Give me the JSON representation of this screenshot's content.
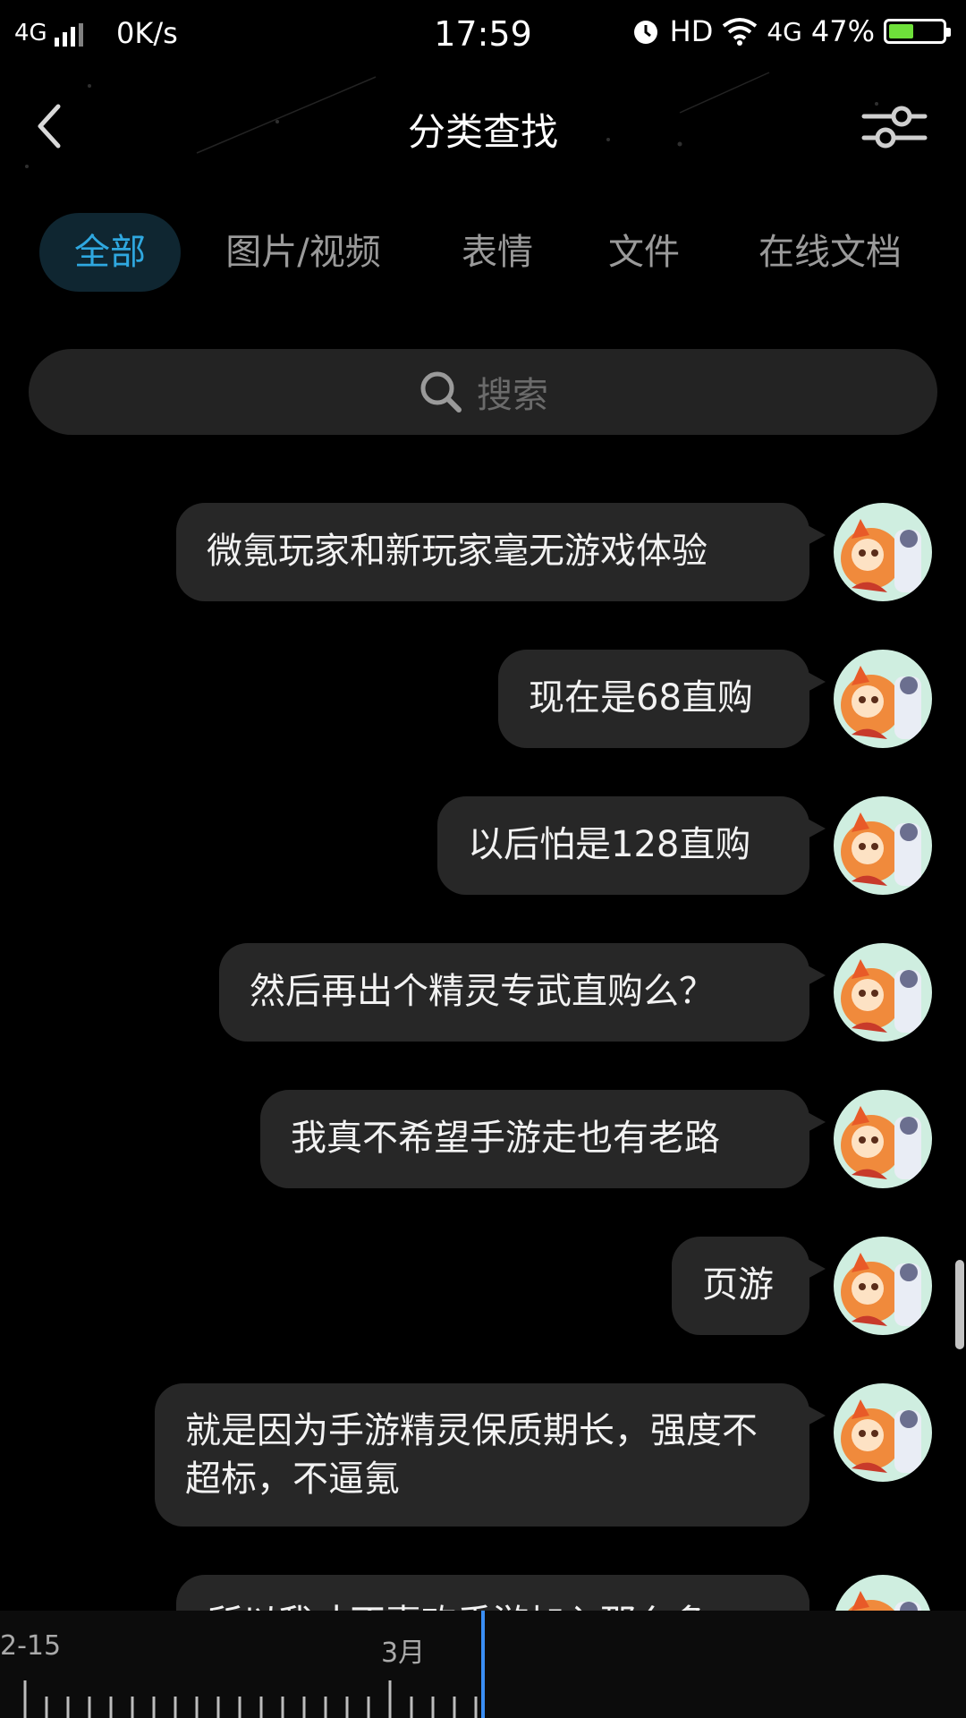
{
  "status_bar": {
    "network": "4G",
    "speed": "0K/s",
    "time": "17:59",
    "hd": "HD",
    "network2": "4G",
    "battery": "47%",
    "battery_level": 0.47
  },
  "header": {
    "title": "分类查找"
  },
  "tabs": [
    {
      "label": "全部",
      "active": true
    },
    {
      "label": "图片/视频",
      "active": false
    },
    {
      "label": "表情",
      "active": false
    },
    {
      "label": "文件",
      "active": false
    },
    {
      "label": "在线文档",
      "active": false
    }
  ],
  "search": {
    "placeholder": "搜索"
  },
  "messages": [
    {
      "text": "微氪玩家和新玩家毫无游戏体验"
    },
    {
      "text": "现在是68直购"
    },
    {
      "text": "以后怕是128直购"
    },
    {
      "text": "然后再出个精灵专武直购么？"
    },
    {
      "text": "我真不希望手游走也有老路"
    },
    {
      "text": "页游"
    },
    {
      "text": "就是因为手游精灵保质期长，强度不超标，不逼氪"
    },
    {
      "text": "所以我才不喜欢手游加入那么多"
    }
  ],
  "timeline": {
    "labels": [
      "2-15",
      "3月"
    ]
  },
  "colors": {
    "accent": "#2fa8e0",
    "bubble": "#272727",
    "background": "#000000"
  }
}
